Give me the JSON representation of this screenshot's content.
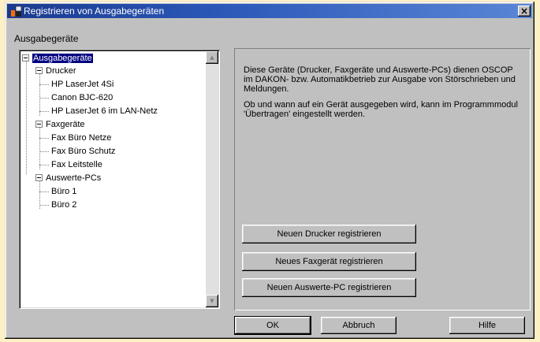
{
  "window": {
    "title": "Registrieren von Ausgabegeräten",
    "close_label": "×"
  },
  "group_label": "Ausgabegeräte",
  "tree": {
    "root": "Ausgabegeräte",
    "drucker": {
      "label": "Drucker",
      "items": [
        "HP LaserJet 4Si",
        "Canon BJC-620",
        "HP LaserJet 6 im LAN-Netz"
      ]
    },
    "fax": {
      "label": "Faxgeräte",
      "items": [
        "Fax Büro Netze",
        "Fax Büro Schutz",
        "Fax Leitstelle"
      ]
    },
    "pcs": {
      "label": "Auswerte-PCs",
      "items": [
        "Büro 1",
        "Büro 2"
      ]
    }
  },
  "info": {
    "paragraph1": "Diese Geräte (Drucker, Faxgeräte und Auswerte-PCs) dienen OSCOP im DAKON- bzw. Automatikbetrieb zur Ausgabe von Störschrieben und Meldungen.",
    "paragraph2": "Ob und wann auf ein Gerät ausgegeben wird, kann im Programmmodul 'Übertragen' eingestellt werden."
  },
  "actions": {
    "register_printer": "Neuen Drucker registrieren",
    "register_fax": "Neues Faxgerät registrieren",
    "register_pc": "Neuen Auswerte-PC registrieren"
  },
  "footer": {
    "ok": "OK",
    "cancel": "Abbruch",
    "help": "Hilfe"
  },
  "colors": {
    "background": "#fdf0c4",
    "dialog": "#c0c0c0",
    "titlebar": "#2b58b8",
    "selection": "#000080"
  }
}
